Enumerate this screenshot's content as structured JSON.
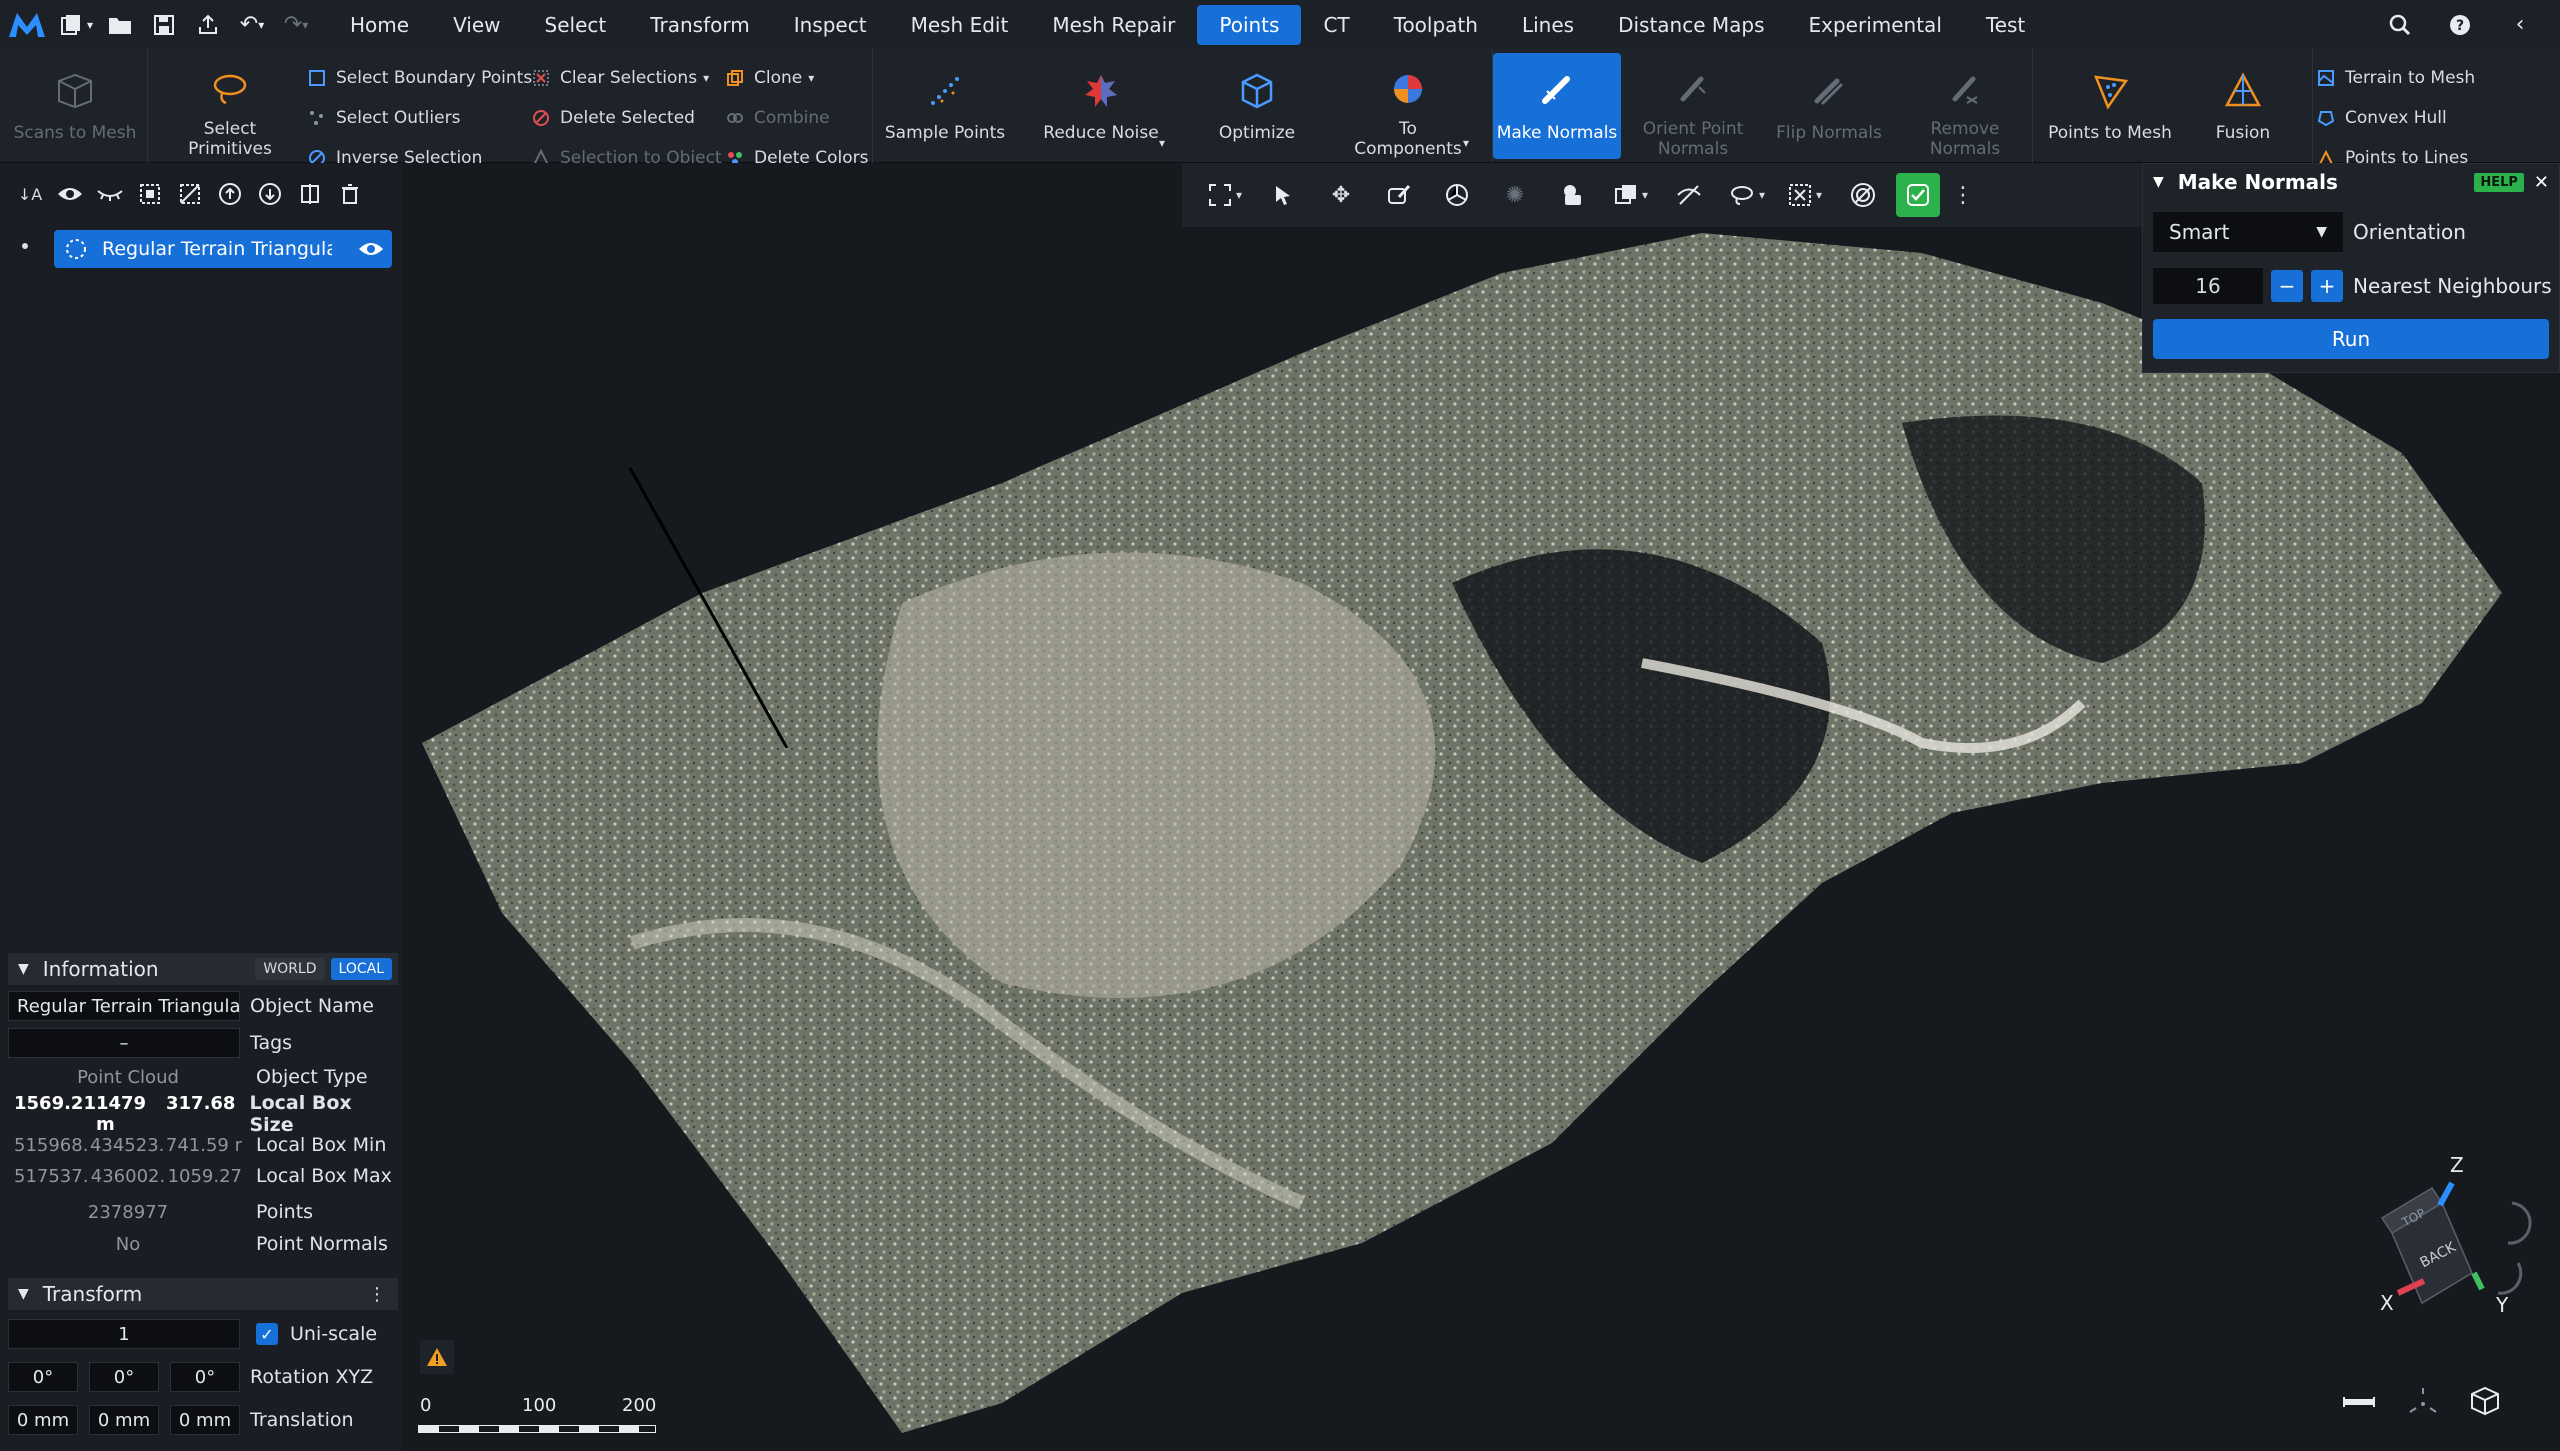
{
  "menubar": {
    "tabs": [
      "Home",
      "View",
      "Select",
      "Transform",
      "Inspect",
      "Mesh Edit",
      "Mesh Repair",
      "Points",
      "CT",
      "Toolpath",
      "Lines",
      "Distance Maps",
      "Experimental",
      "Test"
    ],
    "active_tab": "Points"
  },
  "ribbon": {
    "scans_to_mesh": "Scans to Mesh",
    "select_primitives": "Select Primitives",
    "select_boundary_points": "Select Boundary Points",
    "select_outliers": "Select Outliers",
    "inverse_selection": "Inverse Selection",
    "clear_selections": "Clear Selections",
    "delete_selected": "Delete Selected",
    "selection_to_object": "Selection to Object",
    "clone": "Clone",
    "combine": "Combine",
    "delete_colors": "Delete Colors",
    "sample_points": "Sample Points",
    "reduce_noise": "Reduce Noise",
    "optimize": "Optimize",
    "to_components": "To Components",
    "make_normals": "Make Normals",
    "orient_point_normals": "Orient Point Normals",
    "flip_normals": "Flip Normals",
    "remove_normals": "Remove Normals",
    "points_to_mesh": "Points to Mesh",
    "fusion": "Fusion",
    "terrain_to_mesh": "Terrain to Mesh",
    "convex_hull": "Convex Hull",
    "points_to_lines": "Points to Lines"
  },
  "scene": {
    "item": "Regular Terrain Triangulation"
  },
  "info": {
    "title": "Information",
    "world": "WORLD",
    "local": "LOCAL",
    "object_name_value": "Regular Terrain Triangulation",
    "object_name_label": "Object Name",
    "tags_value": "–",
    "tags_label": "Tags",
    "object_type_value": "Point Cloud",
    "object_type_label": "Object Type",
    "box_size": [
      "1569.21",
      "1479 m",
      "317.68"
    ],
    "box_size_label": "Local Box Size",
    "box_min": [
      "515968.",
      "434523.",
      "741.59 r"
    ],
    "box_min_label": "Local Box Min",
    "box_max": [
      "517537.",
      "436002.",
      "1059.27"
    ],
    "box_max_label": "Local Box Max",
    "points_value": "2378977",
    "points_label": "Points",
    "normals_value": "No",
    "normals_label": "Point Normals"
  },
  "transform": {
    "title": "Transform",
    "scale": "1",
    "uniscale_label": "Uni-scale",
    "rotation": [
      "0°",
      "0°",
      "0°"
    ],
    "rotation_label": "Rotation XYZ",
    "translation": [
      "0 mm",
      "0 mm",
      "0 mm"
    ],
    "translation_label": "Translation"
  },
  "make_normals": {
    "title": "Make Normals",
    "help": "HELP",
    "orientation_value": "Smart",
    "orientation_label": "Orientation",
    "neighbours_value": "16",
    "neighbours_label": "Nearest Neighbours",
    "run": "Run"
  },
  "scalebar": {
    "ticks": [
      "0",
      "100",
      "200"
    ]
  },
  "axes": {
    "x": "X",
    "y": "Y",
    "z": "Z",
    "top": "TOP",
    "back": "BACK"
  },
  "colors": {
    "accent": "#1670d8",
    "ok": "#2bb24c",
    "warning": "#f0a020"
  }
}
